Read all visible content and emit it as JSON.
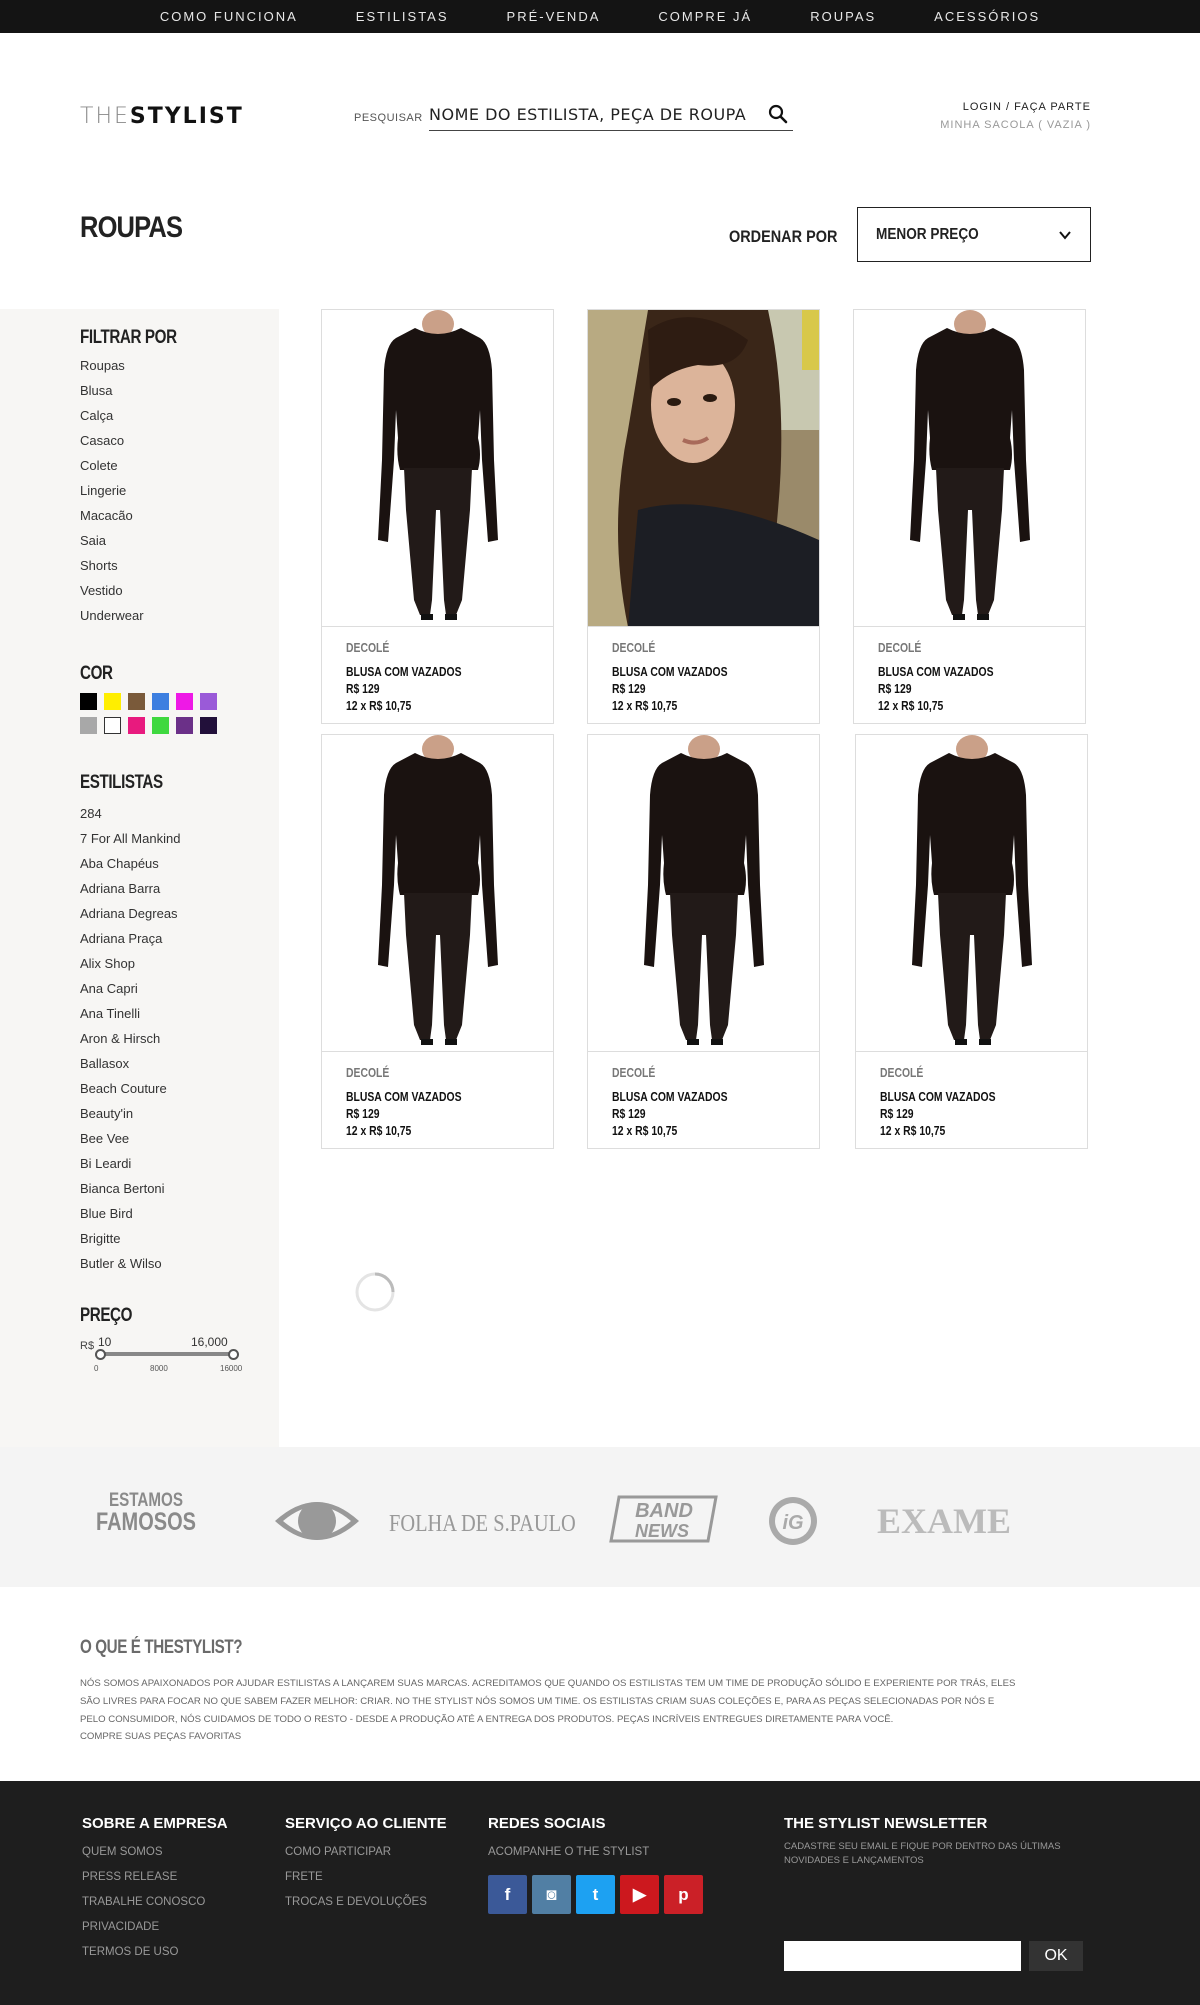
{
  "topnav": [
    "COMO FUNCIONA",
    "ESTILISTAS",
    "PRÉ-VENDA",
    "COMPRE JÁ",
    "ROUPAS",
    "ACESSÓRIOS"
  ],
  "header": {
    "logo_thin": "THE",
    "logo_bold": "STYLIST",
    "search_label": "PESQUISAR",
    "search_placeholder": "NOME DO ESTILISTA, PEÇA DE ROUPA",
    "login": "LOGIN / FAÇA PARTE",
    "bag": "MINHA SACOLA ( VAZIA )"
  },
  "page_title": "ROUPAS",
  "order": {
    "label": "ORDENAR POR",
    "selected": "MENOR PREÇO"
  },
  "filters": {
    "title": "FILTRAR POR",
    "categories": [
      "Roupas",
      "Blusa",
      "Calça",
      "Casaco",
      "Colete",
      "Lingerie",
      "Macacão",
      "Saia",
      "Shorts",
      "Vestido",
      "Underwear"
    ],
    "color_title": "COR",
    "colors": [
      "#000000",
      "#ffee00",
      "#7a5a3a",
      "#3d7fe0",
      "#ee19e6",
      "#9a5ad8",
      "#a8a8a8",
      "#ffffff",
      "#e81a7e",
      "#3fd83f",
      "#6b3088",
      "#22103a"
    ],
    "stylists_title": "ESTILISTAS",
    "stylists": [
      "284",
      "7 For All Mankind",
      "Aba Chapéus",
      "Adriana Barra",
      "Adriana Degreas",
      "Adriana Praça",
      "Alix Shop",
      "Ana Capri",
      "Ana Tinelli",
      "Aron & Hirsch",
      "Ballasox",
      "Beach Couture",
      "Beauty'in",
      "Bee Vee",
      "Bi Leardi",
      "Bianca Bertoni",
      "Blue Bird",
      "Brigitte",
      "Butler & Wilso"
    ],
    "price_title": "PREÇO",
    "price_currency": "R$",
    "price_min": "10",
    "price_max": "16,000",
    "ticks": [
      "0",
      "8000",
      "16000"
    ]
  },
  "products": [
    {
      "brand": "DECOLÉ",
      "name": "BLUSA COM VAZADOS",
      "price": "R$ 129",
      "installments": "12 x R$ 10,75",
      "image": "model-outfit"
    },
    {
      "brand": "DECOLÉ",
      "name": "BLUSA COM VAZADOS",
      "price": "R$ 129",
      "installments": "12 x R$ 10,75",
      "image": "model-portrait"
    },
    {
      "brand": "DECOLÉ",
      "name": "BLUSA COM VAZADOS",
      "price": "R$ 129",
      "installments": "12 x R$ 10,75",
      "image": "model-outfit"
    },
    {
      "brand": "DECOLÉ",
      "name": "BLUSA COM VAZADOS",
      "price": "R$ 129",
      "installments": "12 x R$ 10,75",
      "image": "model-outfit"
    },
    {
      "brand": "DECOLÉ",
      "name": "BLUSA COM VAZADOS",
      "price": "R$ 129",
      "installments": "12 x R$ 10,75",
      "image": "model-outfit"
    },
    {
      "brand": "DECOLÉ",
      "name": "BLUSA COM VAZADOS",
      "price": "R$ 129",
      "installments": "12 x R$ 10,75",
      "image": "model-outfit"
    }
  ],
  "press": {
    "title_line1": "ESTAMOS",
    "title_line2": "FAMOSOS",
    "logos": [
      "Band eye",
      "FOLHA DE S.PAULO",
      "BAND",
      "NEWS",
      "iG",
      "EXAME"
    ]
  },
  "about": {
    "title": "O QUE É THESTYLIST?",
    "text": "Nós somos apaixonados por ajudar estilistas a lançarem suas marcas. Acreditamos que quando os estilistas tem um time de produção sólido e experiente por trás, eles são livres para focar no que sabem fazer melhor: criar. No The Stylist nós somos um time. Os estilistas criam suas coleções e, para as peças selecionadas por nós e pelo consumidor, nós cuidamos de todo o resto - desde a produção até a entrega dos produtos. Peças incríveis entregues diretamente para você.",
    "cta": "Compre suas peças favoritas"
  },
  "footer": {
    "company_title": "SOBRE A EMPRESA",
    "company_links": [
      "QUEM SOMOS",
      "PRESS RELEASE",
      "TRABALHE CONOSCO",
      "PRIVACIDADE",
      "TERMOS DE USO"
    ],
    "service_title": "SERVIÇO AO CLIENTE",
    "service_links": [
      "COMO PARTICIPAR",
      "FRETE",
      "TROCAS E DEVOLUÇÕES"
    ],
    "social_title": "REDES SOCIAIS",
    "social_sub": "ACOMPANHE O THE STYLIST",
    "socials": [
      {
        "name": "facebook",
        "glyph": "f",
        "color": "#3b5998"
      },
      {
        "name": "instagram",
        "glyph": "◙",
        "color": "#517fa4"
      },
      {
        "name": "twitter",
        "glyph": "t",
        "color": "#1da1f2"
      },
      {
        "name": "youtube",
        "glyph": "▶",
        "color": "#cc181e"
      },
      {
        "name": "pinterest",
        "glyph": "p",
        "color": "#cb2027"
      }
    ],
    "newsletter_title": "THE STYLIST NEWSLETTER",
    "newsletter_text": "Cadastre seu email e fique por dentro das últimas novidades e lançamentos",
    "newsletter_button": "OK"
  }
}
